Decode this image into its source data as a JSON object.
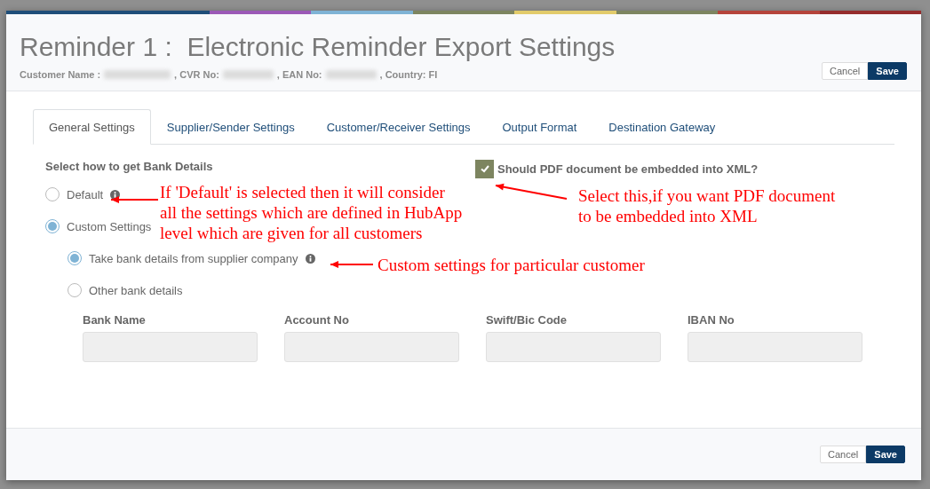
{
  "dialog": {
    "title": "Reminder 1 :  Electronic Reminder Export Settings",
    "customer_info": [
      {
        "label": "Customer Name :",
        "redacted": true
      },
      {
        "label": ", CVR No:",
        "redacted": true
      },
      {
        "label": ", EAN No:",
        "redacted": true
      },
      {
        "label": ", Country: FI",
        "redacted": false
      }
    ],
    "header_buttons": [
      {
        "label": "Cancel",
        "kind": "secondary"
      },
      {
        "label": "Save",
        "kind": "primary"
      }
    ],
    "tabs": [
      {
        "label": "General Settings",
        "selected": true
      },
      {
        "label": "Supplier/Sender Settings",
        "selected": false
      },
      {
        "label": "Customer/Receiver Settings",
        "selected": false
      },
      {
        "label": "Output Format",
        "selected": false
      },
      {
        "label": "Destination Gateway",
        "selected": false
      }
    ],
    "bank_section": {
      "heading": "Select how to get Bank Details",
      "options": [
        {
          "label": "Default",
          "selected": false,
          "info": true
        },
        {
          "label": "Custom Settings",
          "selected": true,
          "info": false,
          "children": [
            {
              "label": "Take bank details from supplier company",
              "selected": true,
              "info": true
            },
            {
              "label": "Other bank details",
              "selected": false,
              "info": false
            }
          ]
        }
      ],
      "fields": [
        {
          "label": "Bank Name",
          "disabled": true
        },
        {
          "label": "Account No",
          "disabled": true
        },
        {
          "label": "Swift/Bic Code",
          "disabled": true
        },
        {
          "label": "IBAN No",
          "disabled": true
        }
      ]
    },
    "embed_pdf": {
      "label": "Should PDF document be embedded into XML?",
      "checked": true
    },
    "footer_buttons": [
      {
        "label": "Cancel",
        "kind": "secondary"
      },
      {
        "label": "Save",
        "kind": "primary"
      }
    ]
  },
  "annotations": [
    {
      "lines": [
        "If 'Default' is selected then it will consider",
        "all the settings which are defined in HubApp",
        "level which are given for all customers"
      ]
    },
    {
      "lines": [
        "Select this,if you want PDF document",
        "to be embedded into XML"
      ]
    },
    {
      "lines": [
        "Custom settings for particular customer"
      ]
    }
  ]
}
